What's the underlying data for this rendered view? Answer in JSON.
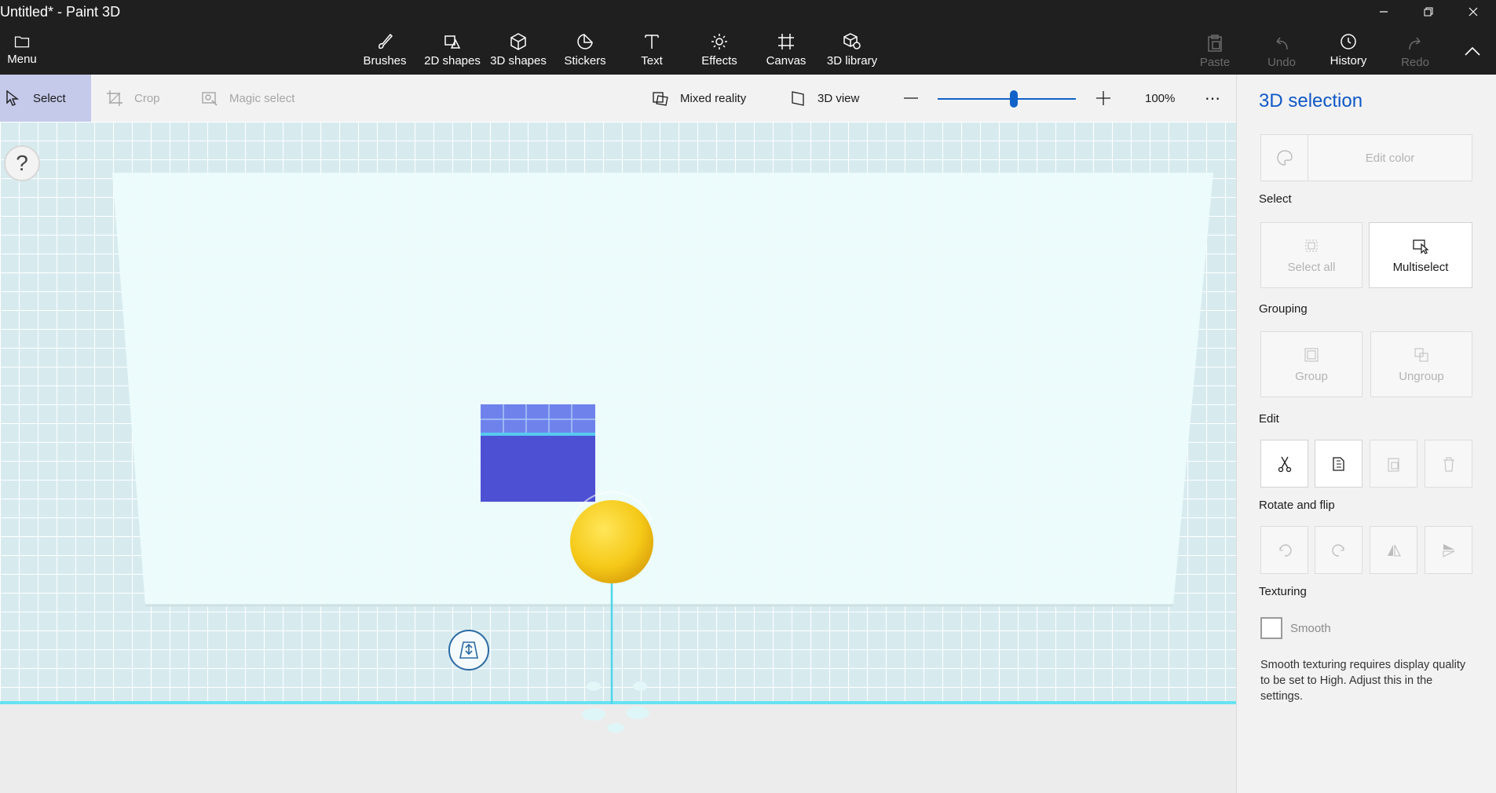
{
  "window": {
    "title": "Untitled* - Paint 3D",
    "controls": [
      "minimize-icon",
      "restore-icon",
      "close-icon"
    ]
  },
  "ribbon": {
    "menu": "Menu",
    "tools": [
      {
        "label": "Brushes",
        "icon": "brush-icon"
      },
      {
        "label": "2D shapes",
        "icon": "2d-shapes-icon"
      },
      {
        "label": "3D shapes",
        "icon": "3d-shapes-icon"
      },
      {
        "label": "Stickers",
        "icon": "stickers-icon"
      },
      {
        "label": "Text",
        "icon": "text-icon"
      },
      {
        "label": "Effects",
        "icon": "effects-icon"
      },
      {
        "label": "Canvas",
        "icon": "canvas-icon"
      },
      {
        "label": "3D library",
        "icon": "3d-library-icon"
      }
    ],
    "actions": [
      {
        "label": "Paste",
        "enabled": false
      },
      {
        "label": "Undo",
        "enabled": false
      },
      {
        "label": "History",
        "enabled": true
      },
      {
        "label": "Redo",
        "enabled": false
      }
    ]
  },
  "toolbar": {
    "select": "Select",
    "crop": "Crop",
    "magic_select": "Magic select",
    "mixed_reality": "Mixed reality",
    "view_3d": "3D view",
    "zoom_value": "100%",
    "zoom_level": 0.55,
    "more": "⋯"
  },
  "canvas": {
    "help": "?",
    "objects": [
      {
        "name": "3d-cube",
        "color": "#4d50d2"
      },
      {
        "name": "3d-sphere",
        "color": "#f5c918"
      }
    ]
  },
  "panel": {
    "title": "3D selection",
    "edit_color": "Edit color",
    "select_label": "Select",
    "select_all": "Select all",
    "multiselect": "Multiselect",
    "grouping_label": "Grouping",
    "group": "Group",
    "ungroup": "Ungroup",
    "edit_label": "Edit",
    "rotate_label": "Rotate and flip",
    "texturing_label": "Texturing",
    "smooth": "Smooth",
    "smooth_note": "Smooth texturing requires display quality to be set to High. Adjust this in the settings."
  },
  "colors": {
    "accent": "#0f58c8",
    "ribbon_bg": "#1f1f1f",
    "selection": "#4dd6ea"
  }
}
